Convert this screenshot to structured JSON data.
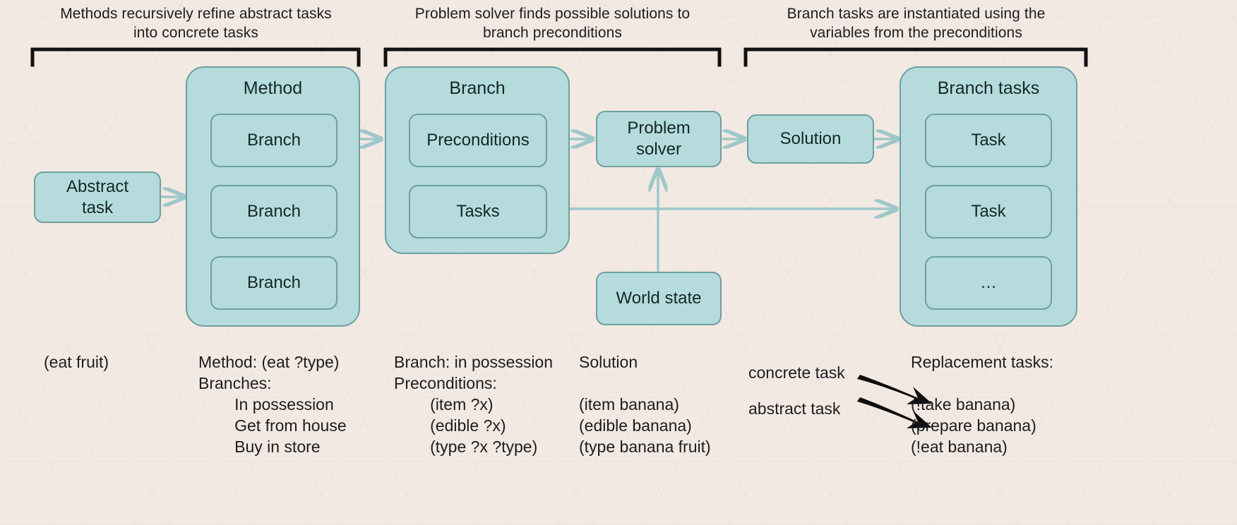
{
  "captions": [
    {
      "id": "caption-methods",
      "text": "Methods recursively refine abstract tasks\ninto concrete tasks"
    },
    {
      "id": "caption-solver",
      "text": "Problem solver finds possible solutions to\nbranch preconditions"
    },
    {
      "id": "caption-instantiate",
      "text": "Branch tasks are instantiated using the\nvariables from the preconditions"
    }
  ],
  "nodes": {
    "abstract_task": "Abstract\ntask",
    "method_title": "Method",
    "method_branches": [
      "Branch",
      "Branch",
      "Branch"
    ],
    "branch_title": "Branch",
    "branch_preconditions": "Preconditions",
    "branch_tasks": "Tasks",
    "problem_solver": "Problem\nsolver",
    "world_state": "World state",
    "solution": "Solution",
    "branch_tasks_title": "Branch tasks",
    "branch_tasks_items": [
      "Task",
      "Task",
      "…"
    ]
  },
  "annotations": {
    "abstract_task_example": "(eat fruit)",
    "method_block": "Method: (eat ?type)\nBranches:\n        In possession\n        Get from house\n        Buy in store",
    "branch_block": "Branch: in possession\nPreconditions:\n        (item ?x)\n        (edible ?x)\n        (type ?x ?type)",
    "solution_title": "Solution",
    "solution_block": "(item banana)\n(edible banana)\n(type banana fruit)",
    "concrete_task_label": "concrete task",
    "abstract_task_label": "abstract task",
    "replacement_title": "Replacement tasks:",
    "replacement_block": "(!take banana)\n(prepare banana)\n(!eat banana)"
  },
  "colors": {
    "background": "#f2e9e3",
    "box_fill": "#b5dbdc",
    "box_border": "#6e9fa0",
    "arrow": "#9ec7c9",
    "text": "#14272b",
    "bracket": "#111111"
  }
}
